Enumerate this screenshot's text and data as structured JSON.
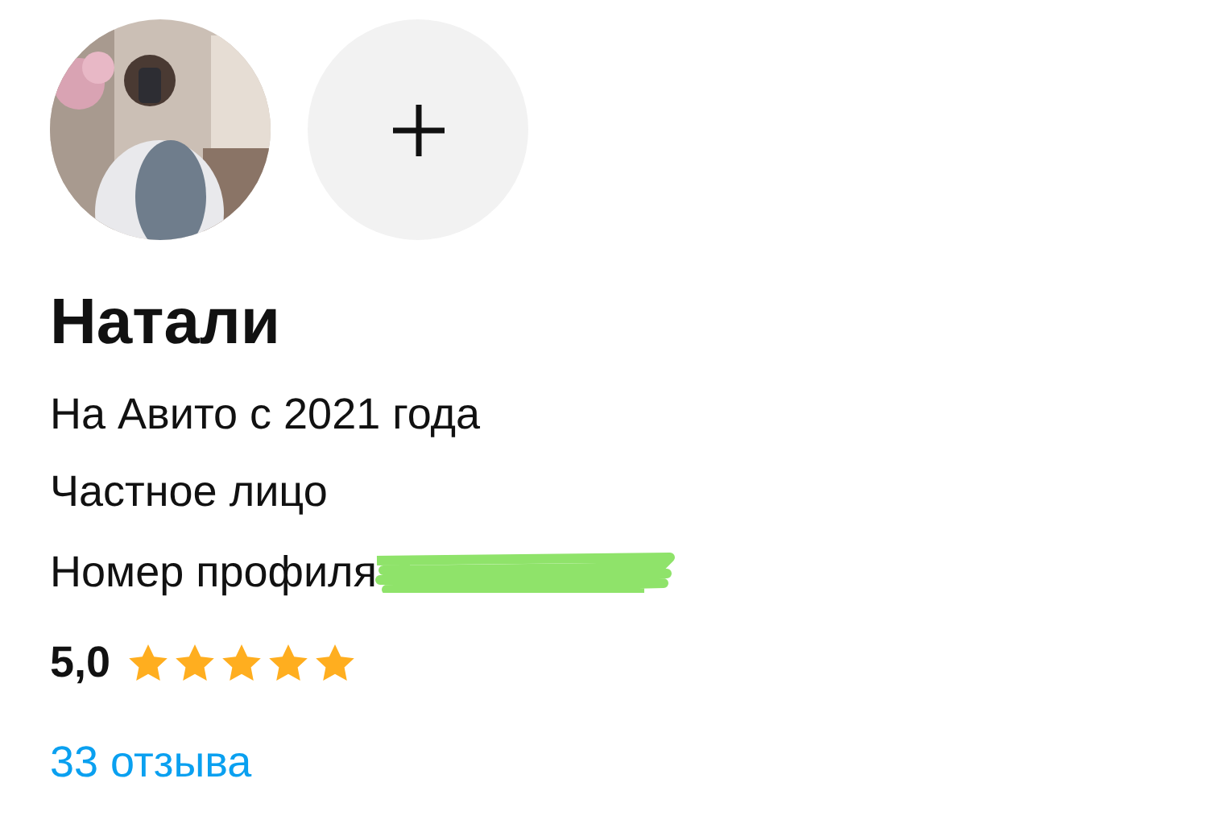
{
  "profile": {
    "name": "Натали",
    "member_since": "На Авито с 2021 года",
    "seller_type": "Частное лицо",
    "profile_number_label": "Номер профиля",
    "rating": {
      "value": "5,0",
      "stars": 5
    },
    "reviews_link": "33 отзыва"
  }
}
